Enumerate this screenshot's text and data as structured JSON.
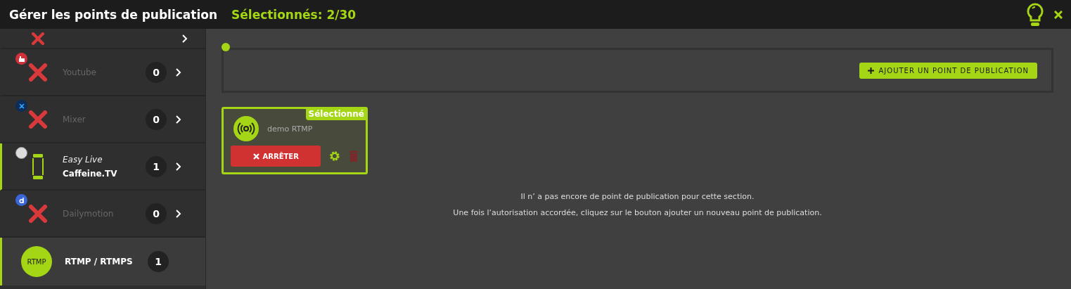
{
  "header": {
    "title": "Gérer les points de publication",
    "selection": "Sélectionnés: 2/30"
  },
  "sidebar": {
    "items": [
      {
        "kind": "cut",
        "selected": false,
        "connected": false
      },
      {
        "kind": "youtube",
        "name": "Youtube",
        "count": "0",
        "selected": false,
        "connected": false
      },
      {
        "kind": "mixer",
        "name": "Mixer",
        "count": "0",
        "selected": false,
        "connected": false
      },
      {
        "kind": "caffeine",
        "mode": "Easy Live",
        "name": "Caffeine.TV",
        "count": "1",
        "selected": false,
        "connected": true
      },
      {
        "kind": "dailymotion",
        "name": "Dailymotion",
        "count": "0",
        "selected": false,
        "connected": false
      },
      {
        "kind": "rtmp",
        "badge": "RTMP",
        "name": "RTMP / RTMPS",
        "count": "1",
        "selected": true,
        "connected": true
      }
    ]
  },
  "add_button": "AJOUTER UN POINT DE PUBLICATION",
  "points": [
    {
      "name": "demo RTMP",
      "tag": "Sélectionné",
      "selected": true,
      "stop_label": "ARRÊTER"
    }
  ],
  "empty_message": [
    "Il n’ a pas encore de point de publication pour cette section.",
    "Une fois l’autorisation accordée, cliquez sur le bouton ajouter un nouveau point de publication."
  ]
}
